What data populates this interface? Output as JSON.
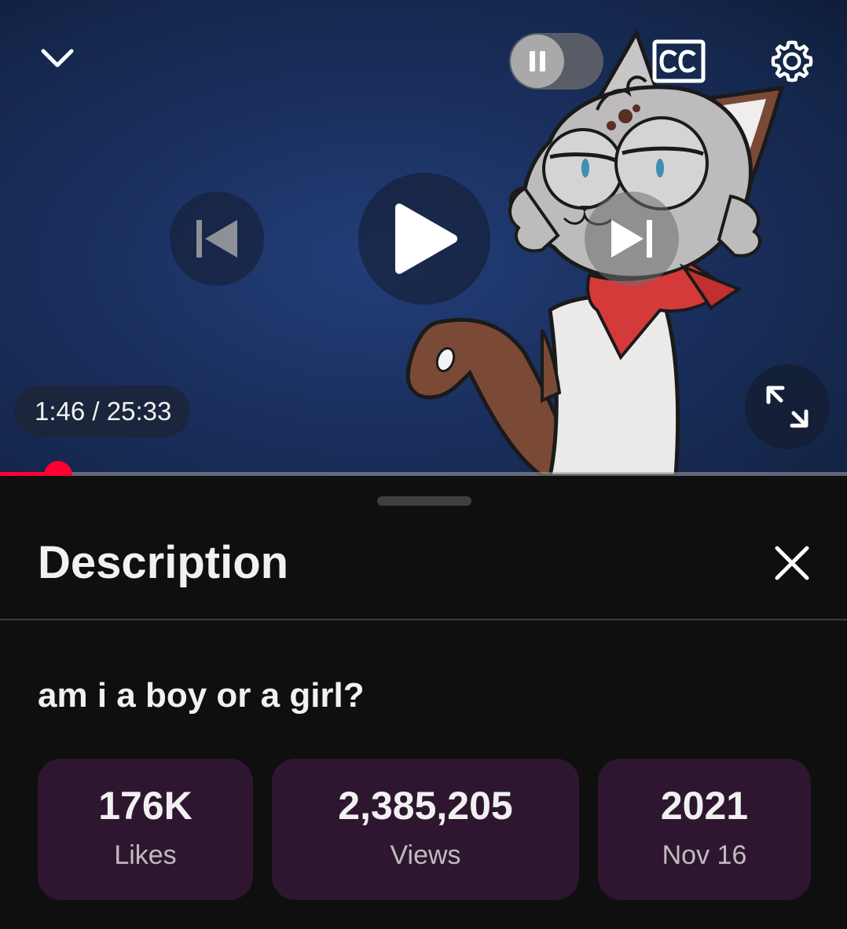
{
  "player": {
    "time_display": "1:46 / 25:33",
    "progress": 0.069,
    "accent_color": "#ff0033",
    "icons": {
      "collapse": "chevron-down-icon",
      "autoplay": "pause-icon",
      "captions": "cc-icon",
      "settings": "gear-icon",
      "previous": "skip-previous-icon",
      "play": "play-icon",
      "next": "skip-next-icon",
      "fullscreen": "fullscreen-icon"
    }
  },
  "description_panel": {
    "title": "Description",
    "close_icon": "close-icon",
    "video_title": "am i a boy or a girl?",
    "stats": {
      "likes": {
        "value": "176K",
        "label": "Likes"
      },
      "views": {
        "value": "2,385,205",
        "label": "Views"
      },
      "date": {
        "value": "2021",
        "label": "Nov 16"
      }
    },
    "stat_background": "#2f1630"
  }
}
